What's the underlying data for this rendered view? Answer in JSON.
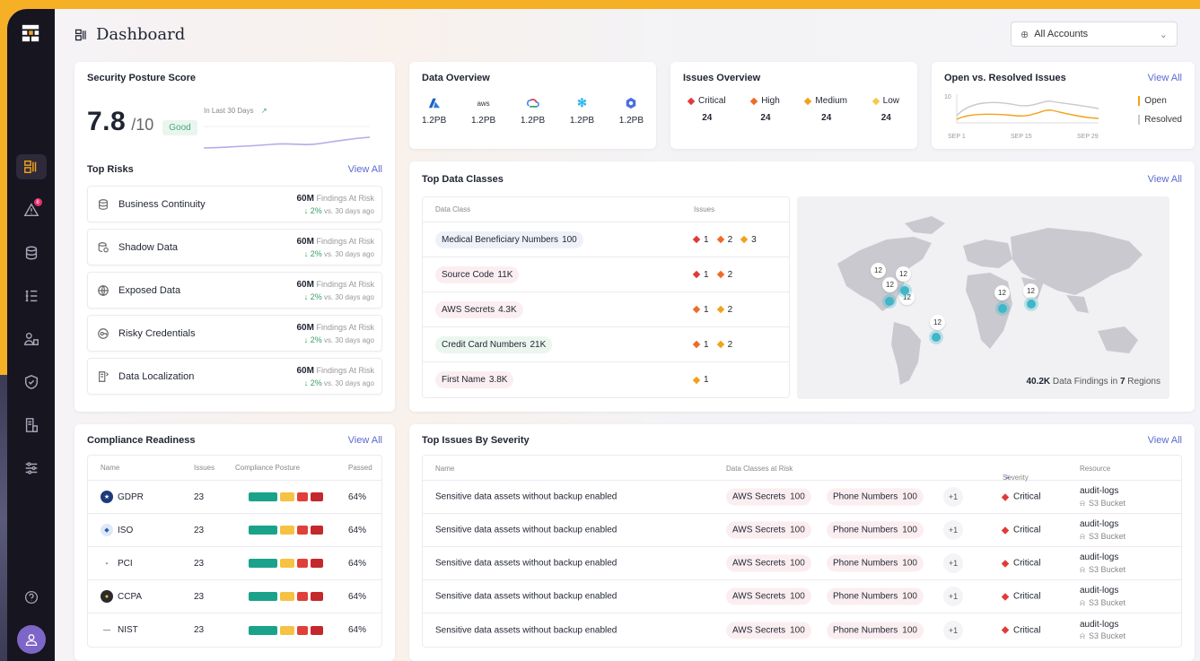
{
  "header": {
    "title": "Dashboard",
    "account_select": "All Accounts"
  },
  "colors": {
    "accent": "#f2a21a",
    "critical": "#e23a3a",
    "high": "#f06a2a",
    "medium": "#f2a21a",
    "low": "#f7c948",
    "frame": "#f6b026",
    "sidebar": "#17151f"
  },
  "sidebar": {
    "badge": "8",
    "icons": [
      "grid-logo",
      "dashboard",
      "alert",
      "database",
      "list",
      "users",
      "shield",
      "reports",
      "settings-sliders",
      "help",
      "user-avatar"
    ]
  },
  "posture": {
    "title": "Security Posture Score",
    "score": "7.8",
    "of": "/10",
    "status": "Good",
    "period": "In Last 30 Days",
    "top_risks_title": "Top Risks",
    "view_all": "View All",
    "risks": [
      {
        "name": "Business Continuity",
        "value": "60M",
        "label": "Findings At Risk",
        "change": "2%",
        "compare": "vs. 30 days ago"
      },
      {
        "name": "Shadow Data",
        "value": "60M",
        "label": "Findings At Risk",
        "change": "2%",
        "compare": "vs. 30 days ago"
      },
      {
        "name": "Exposed Data",
        "value": "60M",
        "label": "Findings At Risk",
        "change": "2%",
        "compare": "vs. 30 days ago"
      },
      {
        "name": "Risky Credentials",
        "value": "60M",
        "label": "Findings At Risk",
        "change": "2%",
        "compare": "vs. 30 days ago"
      },
      {
        "name": "Data Localization",
        "value": "60M",
        "label": "Findings At Risk",
        "change": "2%",
        "compare": "vs. 30 days ago"
      }
    ]
  },
  "data_overview": {
    "title": "Data Overview",
    "providers": [
      {
        "icon": "azure-icon",
        "value": "1.2PB"
      },
      {
        "icon": "aws-icon",
        "value": "1.2PB",
        "logo_text": "aws"
      },
      {
        "icon": "gcp-icon",
        "value": "1.2PB"
      },
      {
        "icon": "snowflake-icon",
        "value": "1.2PB"
      },
      {
        "icon": "hexagon-icon",
        "value": "1.2PB"
      }
    ]
  },
  "issues_overview": {
    "title": "Issues Overview",
    "levels": [
      {
        "label": "Critical",
        "count": "24"
      },
      {
        "label": "High",
        "count": "24"
      },
      {
        "label": "Medium",
        "count": "24"
      },
      {
        "label": "Low",
        "count": "24"
      }
    ]
  },
  "open_resolved": {
    "title": "Open vs. Resolved Issues",
    "view_all": "View All",
    "y_tick": "10",
    "x_ticks": [
      "SEP 1",
      "SEP 15",
      "SEP 29"
    ],
    "legend_open": "Open",
    "legend_resolved": "Resolved"
  },
  "top_data_classes": {
    "title": "Top Data Classes",
    "view_all": "View All",
    "col_class": "Data Class",
    "col_issues": "Issues",
    "rows": [
      {
        "name": "Medical Beneficiary Numbers",
        "count": "100",
        "issues": [
          "1",
          "2",
          "3"
        ]
      },
      {
        "name": "Source Code",
        "count": "11K",
        "issues": [
          "1",
          "2"
        ]
      },
      {
        "name": "AWS Secrets",
        "count": "4.3K",
        "issues": [
          "1",
          "2"
        ]
      },
      {
        "name": "Credit Card Numbers",
        "count": "21K",
        "issues": [
          "1",
          "2"
        ]
      },
      {
        "name": "First Name",
        "count": "3.8K",
        "issues": [
          "1"
        ]
      }
    ],
    "map_markers": [
      "12",
      "12",
      "12",
      "12",
      "12",
      "12",
      "12"
    ],
    "map_summary_value": "40.2K",
    "map_summary_text": "Data Findings in",
    "map_summary_regions": "7",
    "map_summary_suffix": "Regions"
  },
  "compliance": {
    "title": "Compliance Readiness",
    "view_all": "View All",
    "cols": [
      "Name",
      "Issues",
      "Compliance Posture",
      "Passed"
    ],
    "rows": [
      {
        "name": "GDPR",
        "issues": "23",
        "passed": "64%"
      },
      {
        "name": "ISO",
        "issues": "23",
        "passed": "64%"
      },
      {
        "name": "PCI",
        "issues": "23",
        "passed": "64%"
      },
      {
        "name": "CCPA",
        "issues": "23",
        "passed": "64%"
      },
      {
        "name": "NIST",
        "issues": "23",
        "passed": "64%"
      }
    ]
  },
  "top_issues": {
    "title": "Top Issues By Severity",
    "view_all": "View All",
    "cols": [
      "Name",
      "Data Classes at Risk",
      "Severity",
      "Resource"
    ],
    "rows": [
      {
        "name": "Sensitive data assets without backup enabled",
        "c1": "AWS Secrets",
        "c1n": "100",
        "c2": "Phone Numbers",
        "c2n": "100",
        "more": "+1",
        "severity": "Critical",
        "resource": "audit-logs",
        "type": "S3 Bucket"
      },
      {
        "name": "Sensitive data assets without backup enabled",
        "c1": "AWS Secrets",
        "c1n": "100",
        "c2": "Phone Numbers",
        "c2n": "100",
        "more": "+1",
        "severity": "Critical",
        "resource": "audit-logs",
        "type": "S3 Bucket"
      },
      {
        "name": "Sensitive data assets without backup enabled",
        "c1": "AWS Secrets",
        "c1n": "100",
        "c2": "Phone Numbers",
        "c2n": "100",
        "more": "+1",
        "severity": "Critical",
        "resource": "audit-logs",
        "type": "S3 Bucket"
      },
      {
        "name": "Sensitive data assets without backup enabled",
        "c1": "AWS Secrets",
        "c1n": "100",
        "c2": "Phone Numbers",
        "c2n": "100",
        "more": "+1",
        "severity": "Critical",
        "resource": "audit-logs",
        "type": "S3 Bucket"
      },
      {
        "name": "Sensitive data assets without backup enabled",
        "c1": "AWS Secrets",
        "c1n": "100",
        "c2": "Phone Numbers",
        "c2n": "100",
        "more": "+1",
        "severity": "Critical",
        "resource": "audit-logs",
        "type": "S3 Bucket"
      }
    ]
  }
}
